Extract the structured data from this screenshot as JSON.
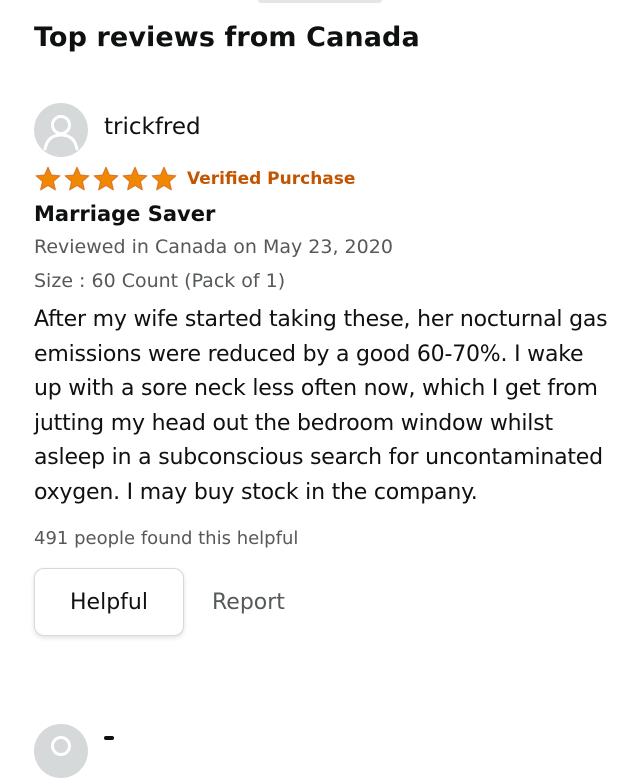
{
  "section": {
    "title": "Top reviews from Canada"
  },
  "review": {
    "avatar_icon": "user-avatar-icon",
    "username": "trickfred",
    "rating": 5,
    "rating_max": 5,
    "star_color": "#f08804",
    "verified_label": "Verified Purchase",
    "verified_color": "#c45500",
    "title": "Marriage Saver",
    "reviewed_line": "Reviewed in Canada on May 23, 2020",
    "size_line": "Size : 60 Count (Pack of 1)",
    "body": "After my wife started taking these, her nocturnal gas emissions were reduced by a good 60-70%. I wake up with a sore neck less often now, which I get from jutting my head out the bedroom window whilst asleep in a subconscious search for uncontaminated oxygen. I may buy stock in the company.",
    "helpful_count_text": "491 people found this helpful",
    "helpful_button": "Helpful",
    "report_link": "Report"
  }
}
